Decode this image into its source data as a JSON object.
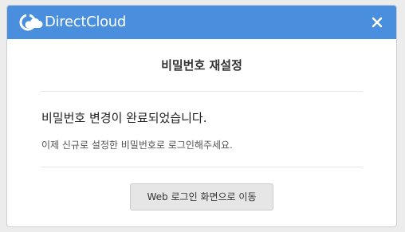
{
  "header": {
    "brand_name": "DirectCloud",
    "brand_color": "#4a8fdd",
    "close_icon": "close-icon"
  },
  "modal": {
    "title": "비밀번호 재설정",
    "message_title": "비밀번호 변경이 완료되었습니다.",
    "message_body": "이제 신규로 설정한 비밀번호로 로그인해주세요.",
    "login_button_label": "Web 로그인 화면으로 이동"
  }
}
